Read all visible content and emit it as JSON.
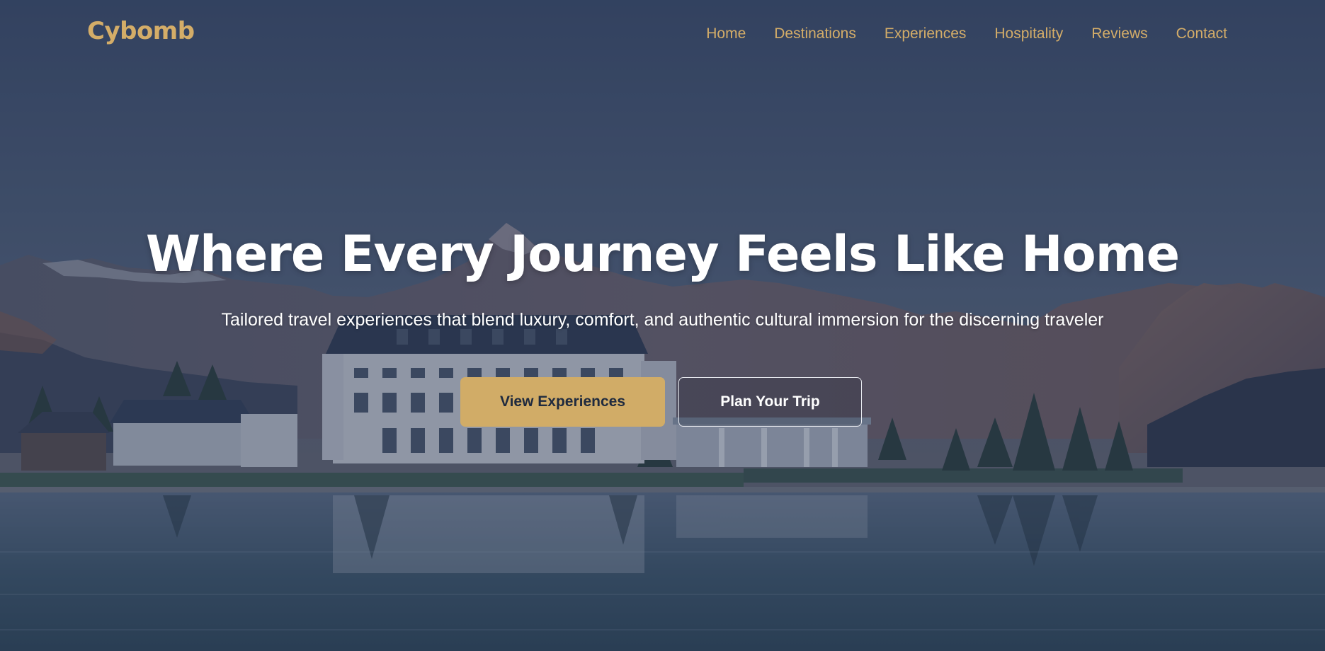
{
  "brand": {
    "logo_text": "Cybomb",
    "accent_color": "#d4ad68"
  },
  "nav": {
    "items": [
      {
        "label": "Home"
      },
      {
        "label": "Destinations"
      },
      {
        "label": "Experiences"
      },
      {
        "label": "Hospitality"
      },
      {
        "label": "Reviews"
      },
      {
        "label": "Contact"
      }
    ]
  },
  "hero": {
    "title": "Where Every Journey Feels Like Home",
    "subtitle": "Tailored travel experiences that blend luxury, comfort, and authentic cultural immersion for the discerning traveler",
    "primary_cta": "View Experiences",
    "secondary_cta": "Plan Your Trip",
    "background_image": "lakeside hotel with mountains at dusk"
  },
  "colors": {
    "overlay": "#3b4c68",
    "primary_button": "#d1ac67",
    "primary_button_text": "#1f2a3e",
    "text": "#ffffff"
  }
}
